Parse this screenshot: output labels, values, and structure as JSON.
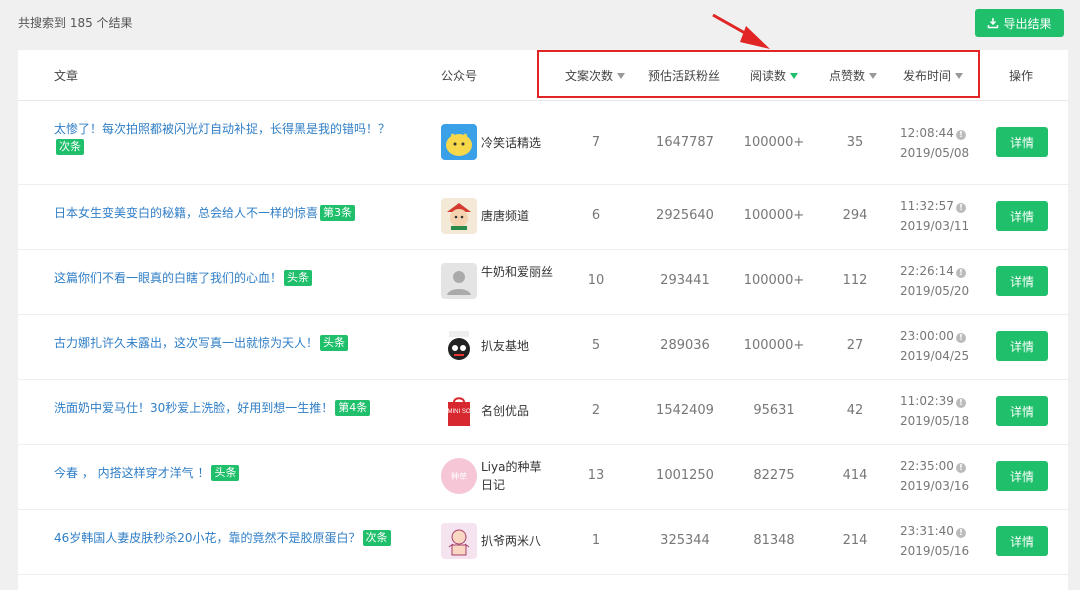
{
  "result_count": "共搜索到 185 个结果",
  "export_label": "导出结果",
  "headers": {
    "article": "文章",
    "account": "公众号",
    "copy_count": "文案次数",
    "active_fans": "预估活跃粉丝",
    "reads": "阅读数",
    "likes": "点赞数",
    "publish_time": "发布时间",
    "action": "操作"
  },
  "rows": [
    {
      "title": "太惨了！每次拍照都被闪光灯自动补捉，长得黑是我的错吗！？",
      "tag": "次条",
      "account": "冷笑话精选",
      "copy_count": "7",
      "active_fans": "1647787",
      "reads": "100000+",
      "likes": "35",
      "time": "12:08:44",
      "date": "2019/05/08",
      "detail": "详情"
    },
    {
      "title": "日本女生变美变白的秘籍，总会给人不一样的惊喜",
      "tag": "第3条",
      "account": "唐唐频道",
      "copy_count": "6",
      "active_fans": "2925640",
      "reads": "100000+",
      "likes": "294",
      "time": "11:32:57",
      "date": "2019/03/11",
      "detail": "详情"
    },
    {
      "title": "这篇你们不看一眼真的白瞎了我们的心血！",
      "tag": "头条",
      "account": "牛奶和爱丽丝",
      "copy_count": "10",
      "active_fans": "293441",
      "reads": "100000+",
      "likes": "112",
      "time": "22:26:14",
      "date": "2019/05/20",
      "detail": "详情"
    },
    {
      "title": "古力娜扎许久未露出，这次写真一出就惊为天人！",
      "tag": "头条",
      "account": "扒友基地",
      "copy_count": "5",
      "active_fans": "289036",
      "reads": "100000+",
      "likes": "27",
      "time": "23:00:00",
      "date": "2019/04/25",
      "detail": "详情"
    },
    {
      "title": "洗面奶中爱马仕！30秒爱上洗脸，好用到想一生推！",
      "tag": "第4条",
      "account": "名创优品",
      "copy_count": "2",
      "active_fans": "1542409",
      "reads": "95631",
      "likes": "42",
      "time": "11:02:39",
      "date": "2019/05/18",
      "detail": "详情"
    },
    {
      "title": "今春 ， 内搭这样穿才洋气 ！",
      "tag": "头条",
      "account": "Liya的种草日记",
      "copy_count": "13",
      "active_fans": "1001250",
      "reads": "82275",
      "likes": "414",
      "time": "22:35:00",
      "date": "2019/03/16",
      "detail": "详情"
    },
    {
      "title": "46岁韩国人妻皮肤秒杀20小花，靠的竟然不是胶原蛋白？",
      "tag": "次条",
      "account": "扒爷两米八",
      "copy_count": "1",
      "active_fans": "325344",
      "reads": "81348",
      "likes": "214",
      "time": "23:31:40",
      "date": "2019/05/16",
      "detail": "详情"
    }
  ],
  "avatar_text": {
    "miniso": "MINI SO",
    "liya": "种草"
  },
  "colors": {
    "accent": "#1fbf6b",
    "link": "#2f7ec6",
    "highlight": "#e12424"
  }
}
